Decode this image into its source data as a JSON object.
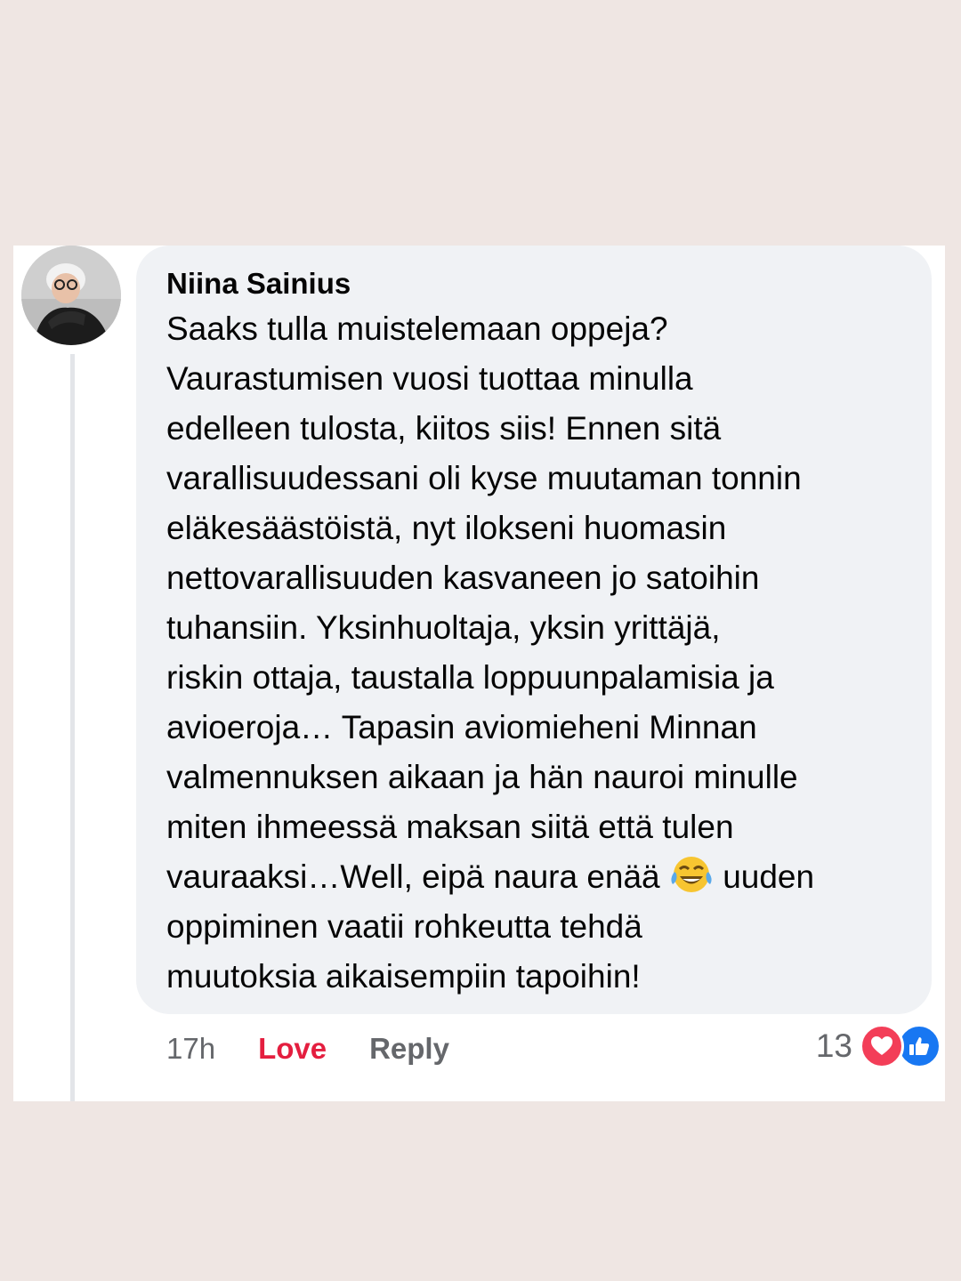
{
  "comment": {
    "author": "Niina Sainius",
    "lines": [
      "Saaks tulla muistelemaan oppeja?",
      "Vaurastumisen vuosi tuottaa minulla",
      "edelleen tulosta, kiitos siis! Ennen sitä",
      "varallisuudessani oli kyse muutaman tonnin",
      "eläkesäästöistä, nyt ilokseni huomasin",
      "nettovarallisuuden kasvaneen jo satoihin",
      "tuhansiin. Yksinhuoltaja, yksin yrittäjä,",
      "riskin ottaja, taustalla  loppuunpalamisia ja",
      "avioeroja… Tapasin aviomieheni Minnan",
      "valmennuksen aikaan ja hän nauroi minulle",
      "miten ihmeessä maksan siitä että tulen",
      "vauraaksi…Well, eipä naura enää",
      "uuden",
      "oppiminen vaatii rohkeutta tehdä",
      "muutoksia aikaisempiin tapoihin!"
    ],
    "emoji": "tears-of-joy-emoji"
  },
  "actions": {
    "time": "17h",
    "love_label": "Love",
    "reply_label": "Reply"
  },
  "reactions": {
    "count": "13",
    "icons": [
      "heart-icon",
      "like-icon"
    ]
  },
  "colors": {
    "background": "#efe6e3",
    "bubble": "#f0f2f5",
    "love": "#e41e3f",
    "heart": "#f33e58",
    "like": "#1877f2",
    "muted": "#65676b"
  }
}
